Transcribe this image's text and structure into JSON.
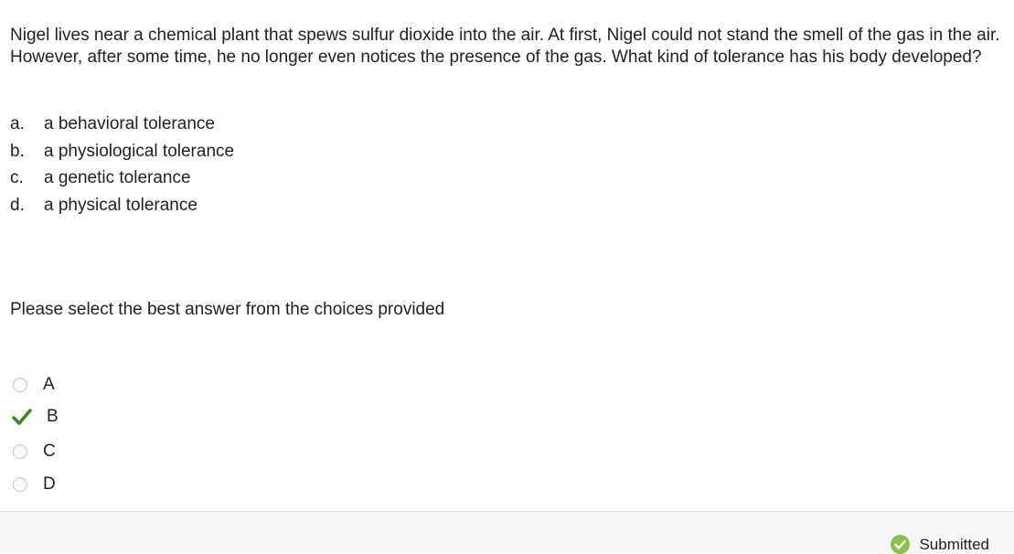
{
  "question": "Nigel lives near a chemical plant that spews sulfur dioxide into the air. At first, Nigel could not stand the smell of the gas in the air. However, after some time, he no longer even notices the presence of the gas. What kind of tolerance has his body developed?",
  "choices": [
    {
      "letter": "a.",
      "text": "a behavioral tolerance"
    },
    {
      "letter": "b.",
      "text": "a physiological tolerance"
    },
    {
      "letter": "c.",
      "text": "a genetic tolerance"
    },
    {
      "letter": "d.",
      "text": "a physical tolerance"
    }
  ],
  "instruction": "Please select the best answer from the choices provided",
  "options": [
    {
      "label": "A",
      "selected": false
    },
    {
      "label": "B",
      "selected": true
    },
    {
      "label": "C",
      "selected": false
    },
    {
      "label": "D",
      "selected": false
    }
  ],
  "footer": {
    "status": "Submitted",
    "status_icon": "check-circle-icon"
  },
  "colors": {
    "check": "#3a8a1e",
    "status_icon": "#8bc34a"
  }
}
